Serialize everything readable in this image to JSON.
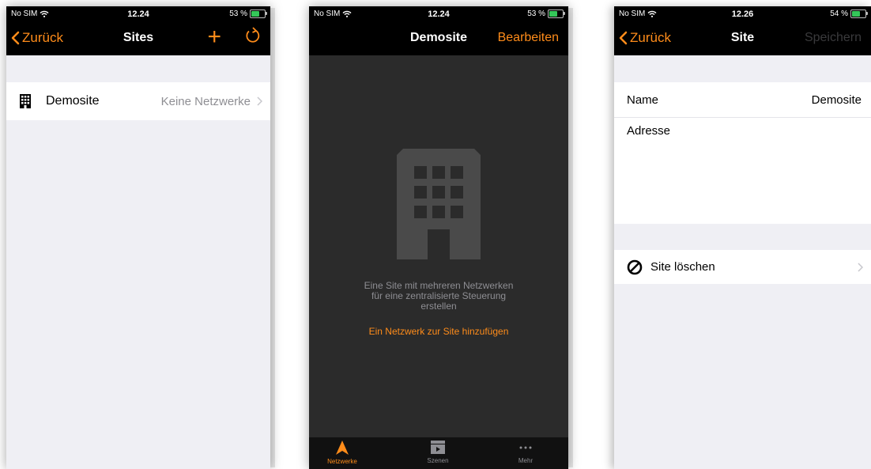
{
  "screen1": {
    "status": {
      "carrier": "No SIM",
      "time": "12.24",
      "battery": "53 %"
    },
    "nav": {
      "back": "Zurück",
      "title": "Sites"
    },
    "row": {
      "label": "Demosite",
      "value": "Keine Netzwerke"
    }
  },
  "screen2": {
    "status": {
      "carrier": "No SIM",
      "time": "12.24",
      "battery": "53 %"
    },
    "nav": {
      "title": "Demosite",
      "right": "Bearbeiten"
    },
    "empty": {
      "line1": "Eine Site mit mehreren Netzwerken",
      "line2": "für eine zentralisierte Steuerung",
      "line3": "erstellen",
      "link": "Ein Netzwerk zur Site hinzufügen"
    },
    "tabs": [
      {
        "label": "Netzwerke",
        "icon": "network-icon"
      },
      {
        "label": "Szenen",
        "icon": "scene-icon"
      },
      {
        "label": "Mehr",
        "icon": "more-icon"
      }
    ]
  },
  "screen3": {
    "status": {
      "carrier": "No SIM",
      "time": "12.26",
      "battery": "54 %"
    },
    "nav": {
      "back": "Zurück",
      "title": "Site",
      "right": "Speichern"
    },
    "name": {
      "label": "Name",
      "value": "Demosite"
    },
    "address": {
      "label": "Adresse"
    },
    "delete": {
      "label": "Site löschen"
    }
  },
  "colors": {
    "accent": "#ff8c1a",
    "battery": "#34c759"
  }
}
